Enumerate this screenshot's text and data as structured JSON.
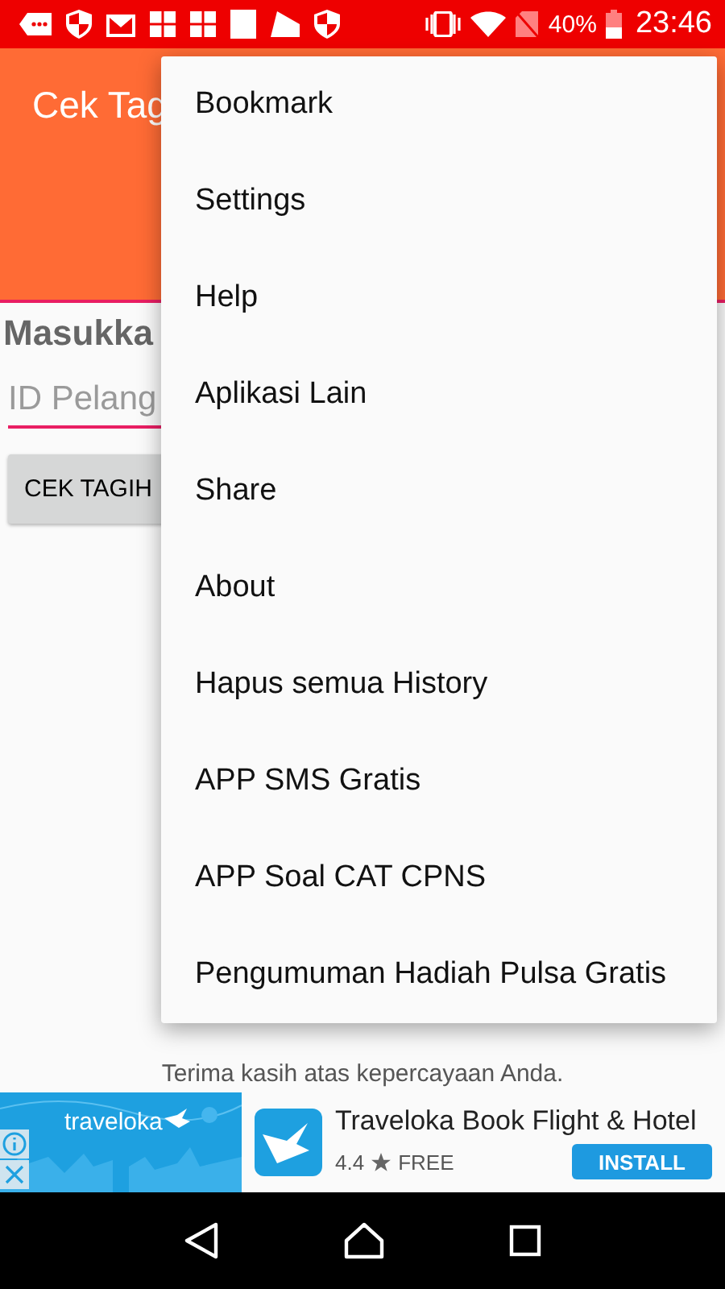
{
  "status_bar": {
    "battery": "40%",
    "time": "23:46"
  },
  "app_bar": {
    "title": "Cek Tag"
  },
  "form": {
    "heading": "Masukka",
    "field": {
      "placeholder": "ID Pelang"
    },
    "button": "CEK TAGIH"
  },
  "footer": {
    "text": "Terima kasih atas kepercayaan Anda."
  },
  "menu": {
    "items": [
      {
        "label": "Bookmark"
      },
      {
        "label": "Settings"
      },
      {
        "label": "Help"
      },
      {
        "label": "Aplikasi Lain"
      },
      {
        "label": "Share"
      },
      {
        "label": "About"
      },
      {
        "label": "Hapus semua History"
      },
      {
        "label": "APP SMS Gratis"
      },
      {
        "label": "APP Soal CAT CPNS"
      },
      {
        "label": "Pengumuman Hadiah Pulsa Gratis"
      }
    ]
  },
  "ad": {
    "banner_brand": "traveloka",
    "title": "Traveloka Book Flight & Hotel",
    "rating": "4.4",
    "price": "FREE",
    "button": "INSTALL"
  }
}
